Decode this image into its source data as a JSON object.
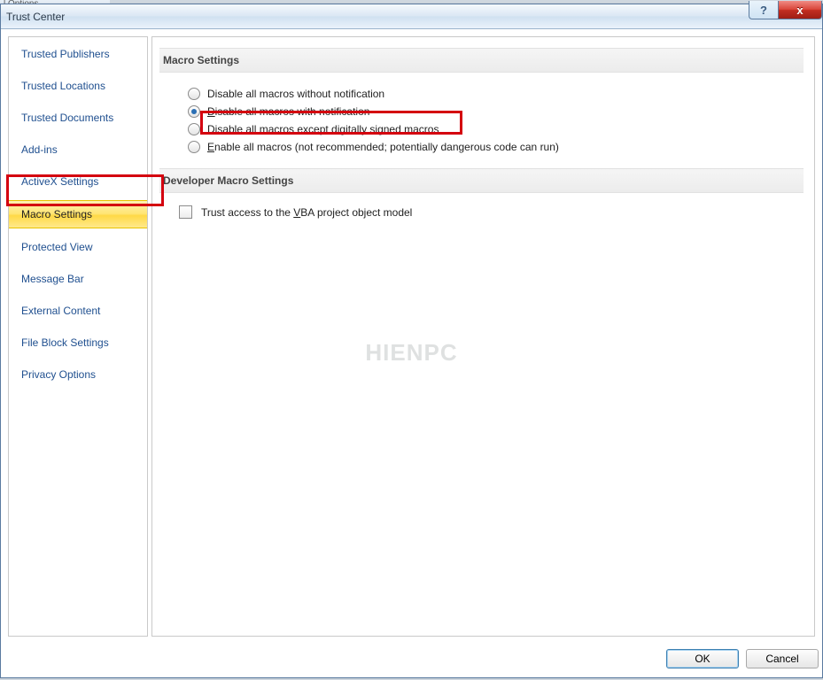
{
  "crop_text": "l Options",
  "window": {
    "title": "Trust Center",
    "help_glyph": "?",
    "close_glyph": "x"
  },
  "sidebar": {
    "items": [
      {
        "label": "Trusted Publishers"
      },
      {
        "label": "Trusted Locations"
      },
      {
        "label": "Trusted Documents"
      },
      {
        "label": "Add-ins"
      },
      {
        "label": "ActiveX Settings"
      },
      {
        "label": "Macro Settings"
      },
      {
        "label": "Protected View"
      },
      {
        "label": "Message Bar"
      },
      {
        "label": "External Content"
      },
      {
        "label": "File Block Settings"
      },
      {
        "label": "Privacy Options"
      }
    ],
    "selected_index": 5
  },
  "sections": {
    "macro": {
      "heading": "Macro Settings",
      "options": [
        {
          "pre": "",
          "u": "",
          "post": "Disable all macros without notification"
        },
        {
          "pre": "",
          "u": "D",
          "post": "isable all macros with notification"
        },
        {
          "pre": "Disable all macros except digitally ",
          "u": "s",
          "post": "igned macros"
        },
        {
          "pre": "",
          "u": "E",
          "post": "nable all macros (not recommended; potentially dangerous code can run)"
        }
      ],
      "selected_option": 1
    },
    "developer": {
      "heading": "Developer Macro Settings",
      "checkbox_pre": "Trust access to the ",
      "checkbox_u": "V",
      "checkbox_post": "BA project object model",
      "checked": false
    }
  },
  "footer": {
    "ok": "OK",
    "cancel": "Cancel"
  },
  "watermark": "HIENPC",
  "colors": {
    "highlight_border": "#d4000f",
    "selected_sidebar_bg": "#ffe574",
    "accent_radio": "#2b6fb4"
  }
}
